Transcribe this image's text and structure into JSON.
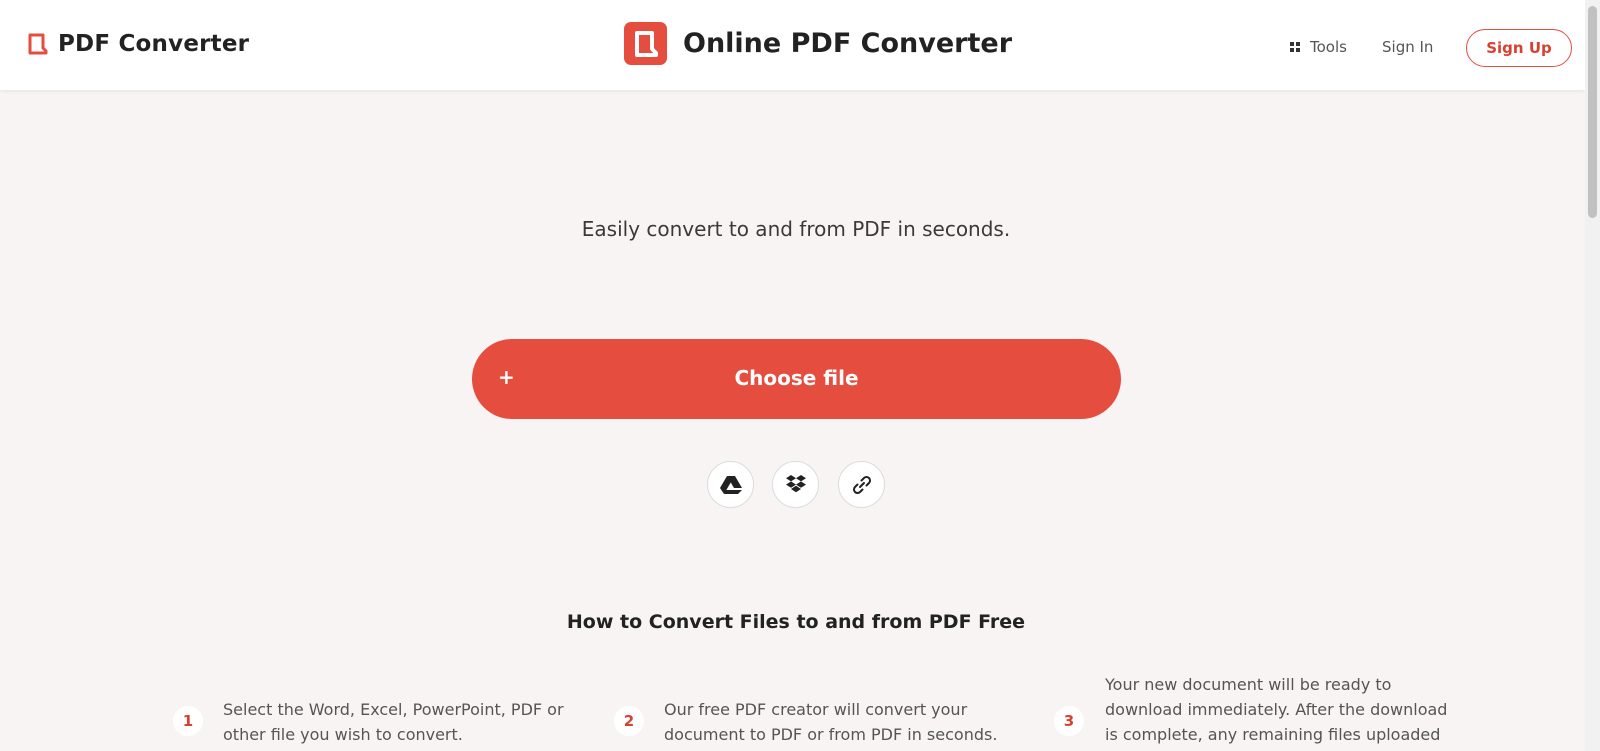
{
  "header": {
    "brand_name": "PDF Converter",
    "center_title": "Online PDF Converter",
    "nav": {
      "tools_label": "Tools",
      "sign_in_label": "Sign In",
      "sign_up_label": "Sign Up"
    }
  },
  "hero": {
    "tagline": "Easily convert to and from PDF in seconds.",
    "choose_file_label": "Choose file",
    "choose_file_icon": "+",
    "sources": [
      "google-drive-icon",
      "dropbox-icon",
      "link-icon"
    ]
  },
  "how_to": {
    "title": "How to Convert Files to and from PDF Free",
    "steps": [
      {
        "number": "1",
        "text": "Select the Word, Excel, PowerPoint, PDF or other file you wish to convert."
      },
      {
        "number": "2",
        "text": "Our free PDF creator will convert your document to PDF or from PDF in seconds."
      },
      {
        "number": "3",
        "text": "Your new document will be ready to download immediately. After the download is complete, any remaining files uploaded"
      }
    ]
  },
  "colors": {
    "accent": "#e54d3e",
    "background": "#f8f4f3"
  }
}
